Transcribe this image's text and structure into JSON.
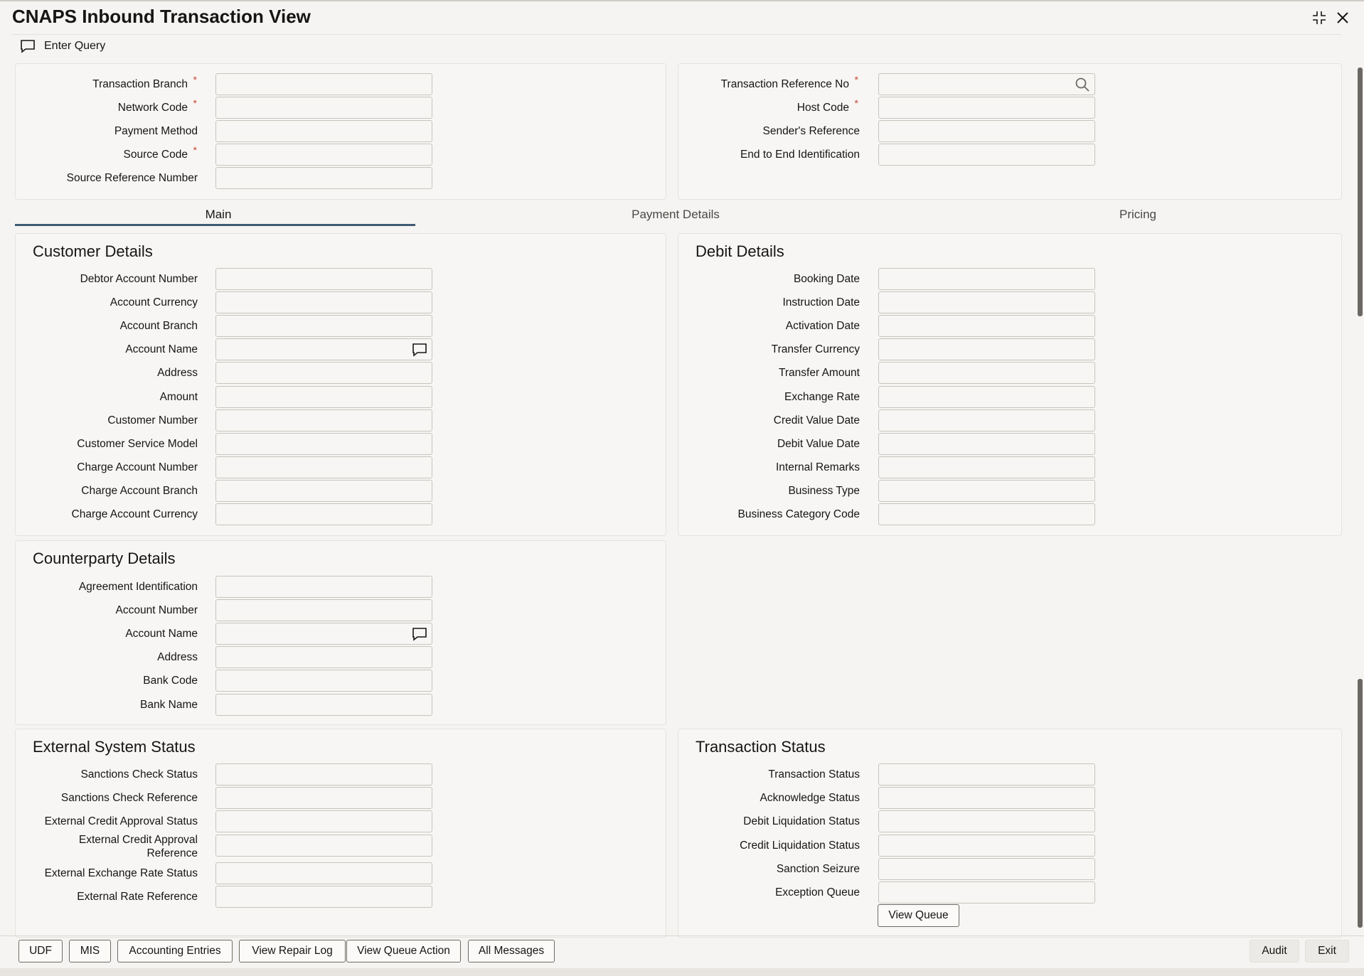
{
  "window": {
    "title": "CNAPS Inbound Transaction View"
  },
  "toolbar": {
    "enter_query": "Enter Query"
  },
  "header_left": [
    {
      "label": "Transaction Branch",
      "required": true,
      "value": ""
    },
    {
      "label": "Network Code",
      "required": true,
      "value": ""
    },
    {
      "label": "Payment Method",
      "required": false,
      "value": ""
    },
    {
      "label": "Source Code",
      "required": true,
      "value": ""
    },
    {
      "label": "Source Reference Number",
      "required": false,
      "value": ""
    }
  ],
  "header_right": [
    {
      "label": "Transaction Reference No",
      "required": true,
      "value": ""
    },
    {
      "label": "Host Code",
      "required": true,
      "value": ""
    },
    {
      "label": "Sender's Reference",
      "required": false,
      "value": ""
    },
    {
      "label": "End to End Identification",
      "required": false,
      "value": ""
    }
  ],
  "tabs": [
    {
      "label": "Main",
      "active": true
    },
    {
      "label": "Payment Details",
      "active": false
    },
    {
      "label": "Pricing",
      "active": false
    }
  ],
  "customer_details": {
    "title": "Customer Details",
    "fields": [
      "Debtor Account Number",
      "Account Currency",
      "Account Branch",
      "Account Name",
      "Address",
      "Amount",
      "Customer Number",
      "Customer Service Model",
      "Charge Account Number",
      "Charge Account Branch",
      "Charge Account Currency"
    ]
  },
  "debit_details": {
    "title": "Debit Details",
    "fields": [
      "Booking Date",
      "Instruction Date",
      "Activation Date",
      "Transfer Currency",
      "Transfer Amount",
      "Exchange Rate",
      "Credit Value Date",
      "Debit Value Date",
      "Internal Remarks",
      "Business Type",
      "Business Category Code"
    ]
  },
  "counterparty_details": {
    "title": "Counterparty Details",
    "fields": [
      "Agreement Identification",
      "Account Number",
      "Account Name",
      "Address",
      "Bank Code",
      "Bank Name"
    ]
  },
  "external_system_status": {
    "title": "External System Status",
    "fields": [
      "Sanctions Check Status",
      "Sanctions Check Reference",
      "External Credit Approval Status",
      "External Credit Approval Reference",
      "External Exchange Rate Status",
      "External Rate Reference"
    ]
  },
  "transaction_status": {
    "title": "Transaction Status",
    "fields": [
      "Transaction Status",
      "Acknowledge Status",
      "Debit Liquidation Status",
      "Credit Liquidation Status",
      "Sanction Seizure",
      "Exception Queue"
    ],
    "view_queue_label": "View Queue"
  },
  "footer": {
    "buttons": [
      "UDF",
      "MIS",
      "Accounting Entries",
      "View Repair Log",
      "View Queue Action",
      "All Messages"
    ],
    "audit_label": "Audit",
    "exit_label": "Exit"
  },
  "icons": {
    "enter_query": "speech-bubble-icon",
    "search": "search-icon",
    "account_name": "speech-bubble-icon",
    "maximize": "collapse-arrows-icon",
    "close": "close-icon"
  }
}
